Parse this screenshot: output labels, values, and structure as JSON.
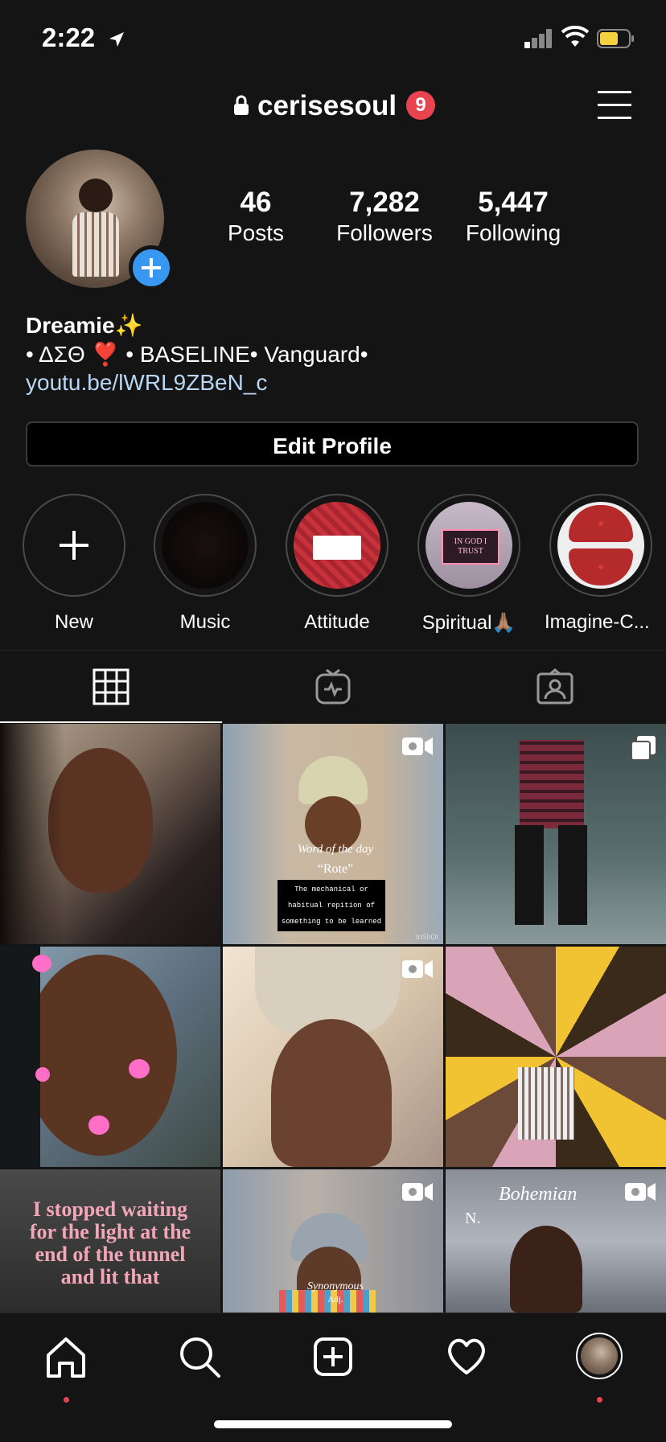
{
  "status_bar": {
    "time": "2:22"
  },
  "header": {
    "username": "cerisesoul",
    "notification_count": "9"
  },
  "profile": {
    "stats": [
      {
        "value": "46",
        "label": "Posts"
      },
      {
        "value": "7,282",
        "label": "Followers"
      },
      {
        "value": "5,447",
        "label": "Following"
      }
    ],
    "display_name": "Dreamie✨",
    "bio": "• ΔΣΘ ❣️ • BASELINE• Vanguard•",
    "link": "youtu.be/lWRL9ZBeN_c",
    "edit_label": "Edit Profile"
  },
  "highlights": [
    {
      "label": "New"
    },
    {
      "label": "Music"
    },
    {
      "label": "Attitude"
    },
    {
      "label": "Spiritual🙏🏽"
    },
    {
      "label": "Imagine-C..."
    }
  ],
  "highlight_spiritual_text": "IN GOD I TRUST",
  "posts": {
    "video_text": {
      "word_title": "Word of the day",
      "word": "“Rote”",
      "definition": "The mechanical or habitual repition of something to be learned",
      "watermark": "InShOt"
    },
    "quote": "I stopped waiting for the light at the end of the tunnel and lit that",
    "synonymous": "Synonymous",
    "synonymous_sub": "Adj.",
    "bohemian": "Bohemian",
    "bohemian_sub": "N."
  },
  "icons": {
    "colors": {
      "accent": "#3897f0",
      "badge": "#e8444f",
      "battery": "#f5d142",
      "link": "#b9d6f5"
    }
  }
}
